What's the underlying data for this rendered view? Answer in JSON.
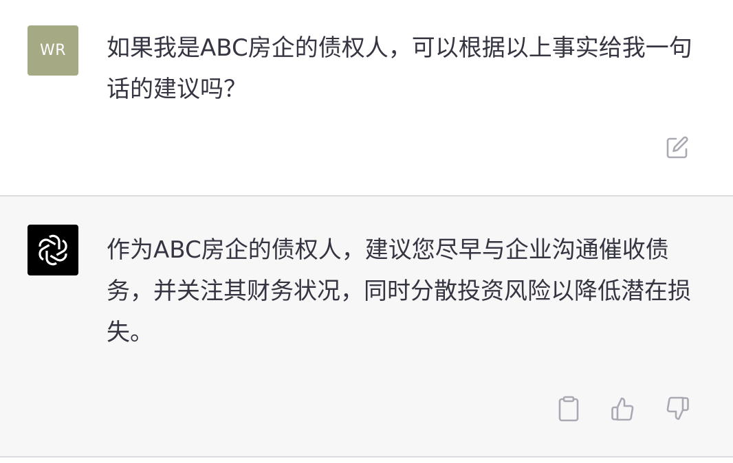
{
  "conversation": {
    "user_message": {
      "avatar_initials": "WR",
      "avatar_color": "#a5aa85",
      "text": "如果我是ABC房企的债权人，可以根据以上事实给我一句话的建议吗？",
      "actions": {
        "edit_icon": "edit-icon"
      }
    },
    "assistant_message": {
      "avatar_icon": "openai-logo-icon",
      "text": "作为ABC房企的债权人，建议您尽早与企业沟通催收债务，并关注其财务状况，同时分散投资风险以降低潜在损失。",
      "actions": {
        "copy_icon": "clipboard-icon",
        "thumbs_up_icon": "thumbs-up-icon",
        "thumbs_down_icon": "thumbs-down-icon"
      }
    }
  },
  "colors": {
    "assistant_bg": "#f7f7f8",
    "text": "#343541",
    "icon": "#a9a9b3"
  }
}
